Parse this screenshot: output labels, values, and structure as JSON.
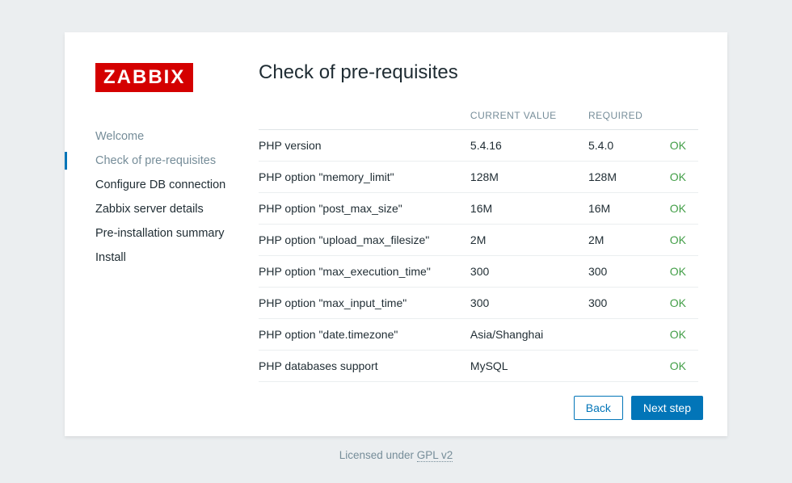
{
  "brand": "ZABBIX",
  "page_title": "Check of pre-requisites",
  "sidebar": {
    "steps": [
      {
        "label": "Welcome",
        "state": "done"
      },
      {
        "label": "Check of pre-requisites",
        "state": "current"
      },
      {
        "label": "Configure DB connection",
        "state": "future"
      },
      {
        "label": "Zabbix server details",
        "state": "future"
      },
      {
        "label": "Pre-installation summary",
        "state": "future"
      },
      {
        "label": "Install",
        "state": "future"
      }
    ]
  },
  "table": {
    "headers": {
      "check": "",
      "current": "CURRENT VALUE",
      "required": "REQUIRED",
      "status": ""
    },
    "rows": [
      {
        "check": "PHP version",
        "current": "5.4.16",
        "required": "5.4.0",
        "status": "OK"
      },
      {
        "check": "PHP option \"memory_limit\"",
        "current": "128M",
        "required": "128M",
        "status": "OK"
      },
      {
        "check": "PHP option \"post_max_size\"",
        "current": "16M",
        "required": "16M",
        "status": "OK"
      },
      {
        "check": "PHP option \"upload_max_filesize\"",
        "current": "2M",
        "required": "2M",
        "status": "OK"
      },
      {
        "check": "PHP option \"max_execution_time\"",
        "current": "300",
        "required": "300",
        "status": "OK"
      },
      {
        "check": "PHP option \"max_input_time\"",
        "current": "300",
        "required": "300",
        "status": "OK"
      },
      {
        "check": "PHP option \"date.timezone\"",
        "current": "Asia/Shanghai",
        "required": "",
        "status": "OK"
      },
      {
        "check": "PHP databases support",
        "current": "MySQL",
        "required": "",
        "status": "OK"
      }
    ]
  },
  "buttons": {
    "back": "Back",
    "next": "Next step"
  },
  "license": {
    "prefix": "Licensed under ",
    "link": "GPL v2"
  }
}
